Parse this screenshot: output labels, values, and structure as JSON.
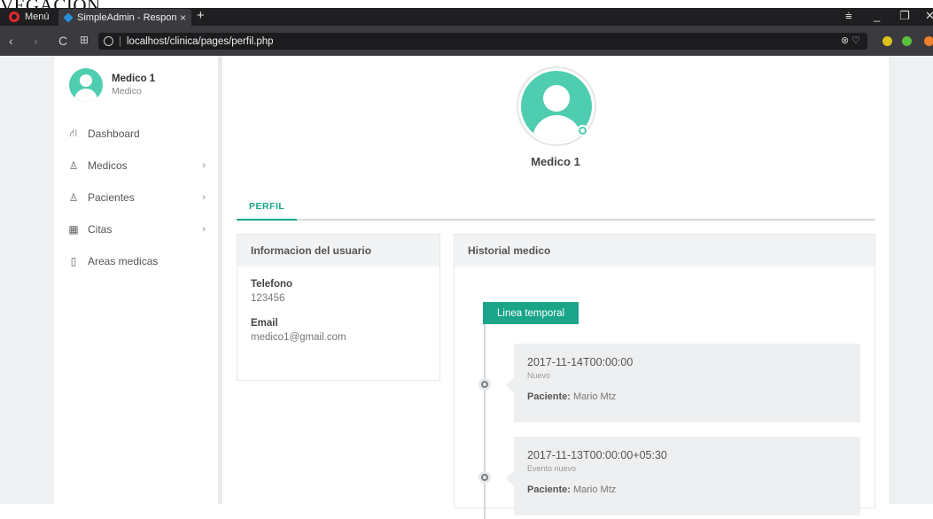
{
  "page_top_text": "VEGACION",
  "browser": {
    "menu_label": "Menú",
    "tab_title": "SimpleAdmin - Responsive",
    "tab_close": "×",
    "new_tab": "+",
    "url": "localhost/clinica/pages/perfil.php",
    "url_right_icons": "⊗ ♡",
    "back": "‹",
    "forward": "›",
    "reload": "C",
    "speed_dial": "⊞",
    "win_minimize": "_",
    "win_restore": "❐",
    "win_close": "✕",
    "win_stash": "⩧"
  },
  "sidebar": {
    "user_name": "Medico 1",
    "user_role": "Medico",
    "items": [
      {
        "label": "Dashboard",
        "icon": "⛙",
        "has_chevron": false
      },
      {
        "label": "Medicos",
        "icon": "♙",
        "has_chevron": true
      },
      {
        "label": "Pacientes",
        "icon": "♙",
        "has_chevron": true
      },
      {
        "label": "Citas",
        "icon": "▦",
        "has_chevron": true
      },
      {
        "label": "Areas medicas",
        "icon": "▯",
        "has_chevron": false
      }
    ],
    "chevron": "›"
  },
  "profile": {
    "name": "Medico 1",
    "tab_label": "PERFIL"
  },
  "info_card": {
    "title": "Informacion del usuario",
    "phone_label": "Telefono",
    "phone_value": "123456",
    "email_label": "Email",
    "email_value": "medico1@gmail.com"
  },
  "history_card": {
    "title": "Historial medico",
    "timeline_button": "Linea temporal",
    "patient_label": "Paciente:",
    "events": [
      {
        "date": "2017-11-14T00:00:00",
        "description": "Nuevo",
        "patient": "Mario Mtz"
      },
      {
        "date": "2017-11-13T00:00:00+05:30",
        "description": "Evento nuevo",
        "patient": "Mario Mtz"
      }
    ]
  },
  "colors": {
    "accent": "#1aa589",
    "avatar": "#4ecdb0",
    "opera_red": "#e3262d"
  }
}
